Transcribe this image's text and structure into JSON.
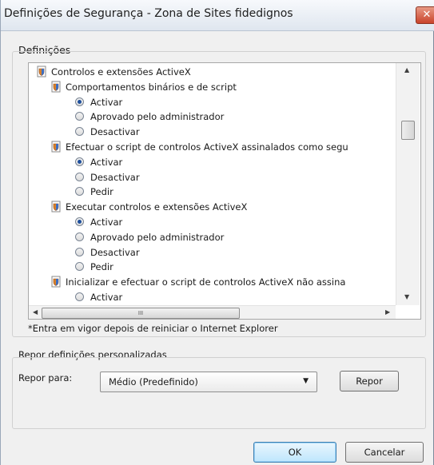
{
  "window": {
    "title": "Definições de Segurança - Zona de Sites fidedignos",
    "close_glyph": "✕"
  },
  "settings": {
    "group_label": "Definições",
    "tree": [
      {
        "type": "category",
        "icon": "settings-shield-icon",
        "label": "Controlos e extensões ActiveX"
      },
      {
        "type": "setting",
        "icon": "settings-shield-icon",
        "label": "Comportamentos binários e de script"
      },
      {
        "type": "option",
        "label": "Activar",
        "checked": true
      },
      {
        "type": "option",
        "label": "Aprovado pelo administrador",
        "checked": false
      },
      {
        "type": "option",
        "label": "Desactivar",
        "checked": false
      },
      {
        "type": "setting",
        "icon": "settings-shield-icon",
        "label": "Efectuar o script de controlos ActiveX assinalados como segu"
      },
      {
        "type": "option",
        "label": "Activar",
        "checked": true
      },
      {
        "type": "option",
        "label": "Desactivar",
        "checked": false
      },
      {
        "type": "option",
        "label": "Pedir",
        "checked": false
      },
      {
        "type": "setting",
        "icon": "settings-shield-icon",
        "label": "Executar controlos e extensões ActiveX"
      },
      {
        "type": "option",
        "label": "Activar",
        "checked": true
      },
      {
        "type": "option",
        "label": "Aprovado pelo administrador",
        "checked": false
      },
      {
        "type": "option",
        "label": "Desactivar",
        "checked": false
      },
      {
        "type": "option",
        "label": "Pedir",
        "checked": false
      },
      {
        "type": "setting",
        "icon": "settings-shield-icon",
        "label": "Inicializar e efectuar o script de controlos ActiveX não assina"
      },
      {
        "type": "option",
        "label": "Activar",
        "checked": false
      }
    ],
    "hscroll_grip": "III",
    "note": "*Entra em vigor depois de reiniciar o Internet Explorer"
  },
  "reset": {
    "group_label": "Repor definições personalizadas",
    "reset_to_label": "Repor para:",
    "select_value": "Médio (Predefinido)",
    "reset_button": "Repor"
  },
  "footer": {
    "ok_button": "OK",
    "cancel_button": "Cancelar"
  }
}
